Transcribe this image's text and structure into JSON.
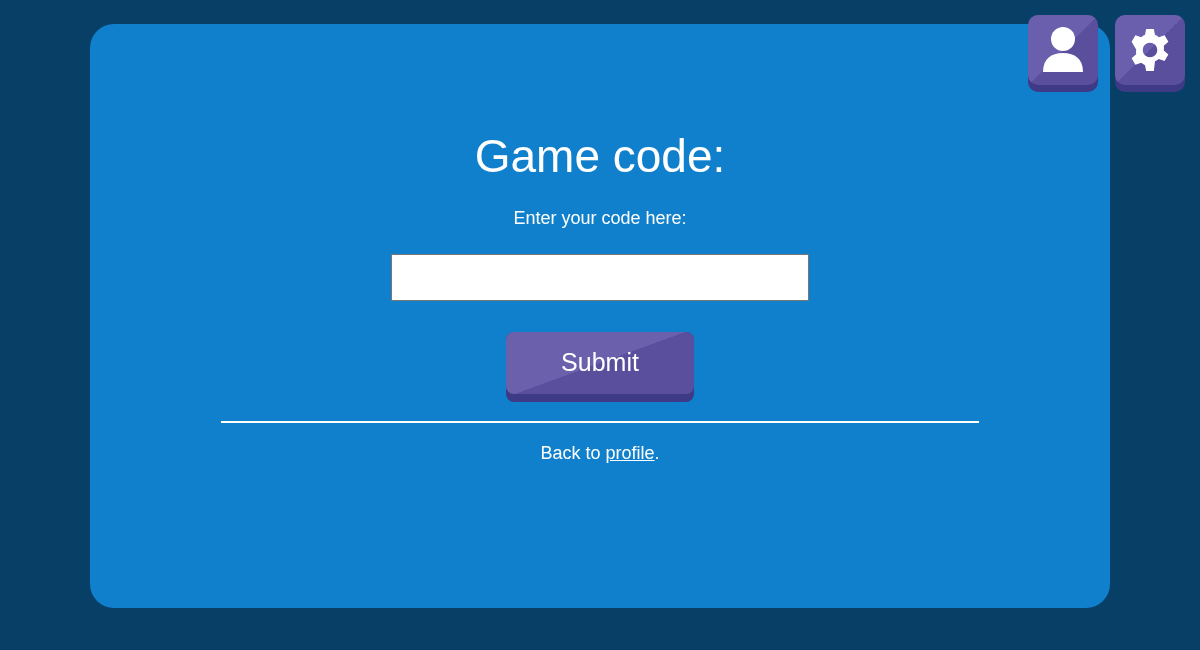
{
  "title": "Game code:",
  "prompt": "Enter your code here:",
  "submit": {
    "label": "Submit"
  },
  "back": {
    "before": "Back to ",
    "link": "profile",
    "after": "."
  }
}
